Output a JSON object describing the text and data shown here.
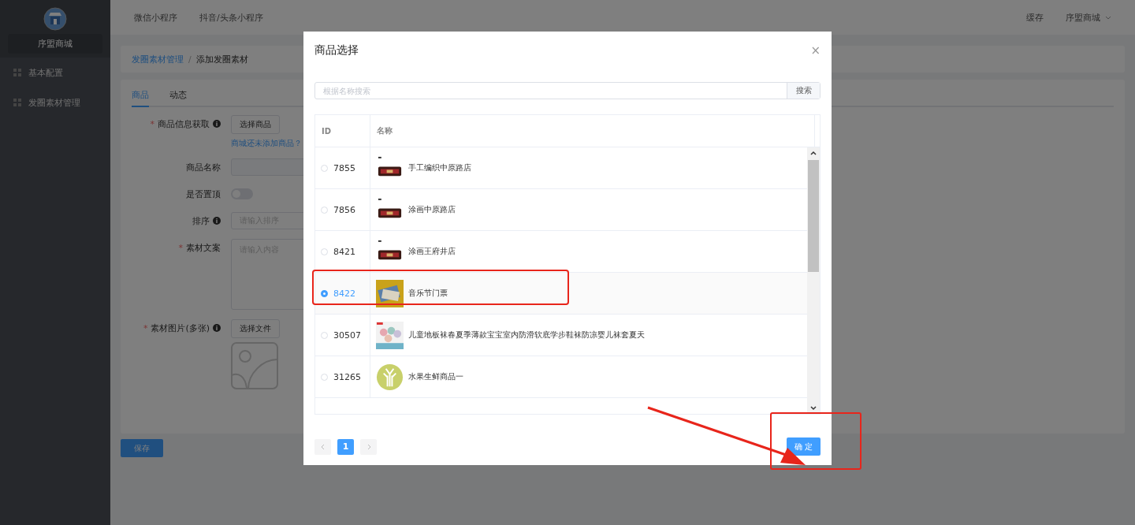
{
  "sidebar": {
    "brand": "序盟商城",
    "items": [
      {
        "label": "基本配置"
      },
      {
        "label": "发圈素材管理"
      }
    ]
  },
  "topbar": {
    "tabs": [
      "微信小程序",
      "抖音/头条小程序"
    ],
    "cache": "缓存",
    "user": "序盟商城"
  },
  "breadcrumb": {
    "link": "发圈素材管理",
    "separator": "/",
    "current": "添加发圈素材"
  },
  "form": {
    "tabs": [
      {
        "label": "商品",
        "selected": true
      },
      {
        "label": "动态",
        "selected": false
      }
    ],
    "fields": [
      {
        "kind": "button",
        "label": "商品信息获取",
        "required_mark": "*",
        "info": true,
        "button": "选择商品",
        "link": "商城还未添加商品？"
      },
      {
        "kind": "text",
        "label": "商品名称",
        "info": false
      },
      {
        "kind": "switch",
        "label": "是否置顶",
        "info": false,
        "on": false
      },
      {
        "kind": "input",
        "label": "排序",
        "info": true,
        "placeholder": "请输入排序"
      },
      {
        "kind": "textarea",
        "label": "素材文案",
        "required_mark": "*",
        "info": false,
        "placeholder": "请输入内容"
      },
      {
        "kind": "upload",
        "label": "素材图片(多张)",
        "required_mark": "*",
        "info": true,
        "button": "选择文件"
      }
    ],
    "save": "保存"
  },
  "dialog": {
    "title": "商品选择",
    "close": "×",
    "search": {
      "placeholder": "根据名称搜索",
      "button": "搜索"
    },
    "columns": [
      "ID",
      "名称"
    ],
    "rows": [
      {
        "id": "7855",
        "name": "手工编织中原路店",
        "thumb": {
          "kind": "bag"
        },
        "selected": false
      },
      {
        "id": "7856",
        "name": "涂画中原路店",
        "thumb": {
          "kind": "bag"
        },
        "selected": false
      },
      {
        "id": "8421",
        "name": "涂画王府井店",
        "thumb": {
          "kind": "bag"
        },
        "selected": false
      },
      {
        "id": "8422",
        "name": "音乐节门票",
        "thumb": {
          "kind": "tickets"
        },
        "selected": true
      },
      {
        "id": "30507",
        "name": "儿童地板袜春夏季薄款宝宝室内防滑软底学步鞋袜防凉婴儿袜套夏天",
        "thumb": {
          "kind": "socks"
        },
        "selected": false
      },
      {
        "id": "31265",
        "name": "水果生鲜商品一",
        "thumb": {
          "kind": "plant"
        },
        "selected": false
      }
    ],
    "pages": [
      {
        "label": "1",
        "selected": true
      }
    ],
    "confirm": "确 定"
  }
}
